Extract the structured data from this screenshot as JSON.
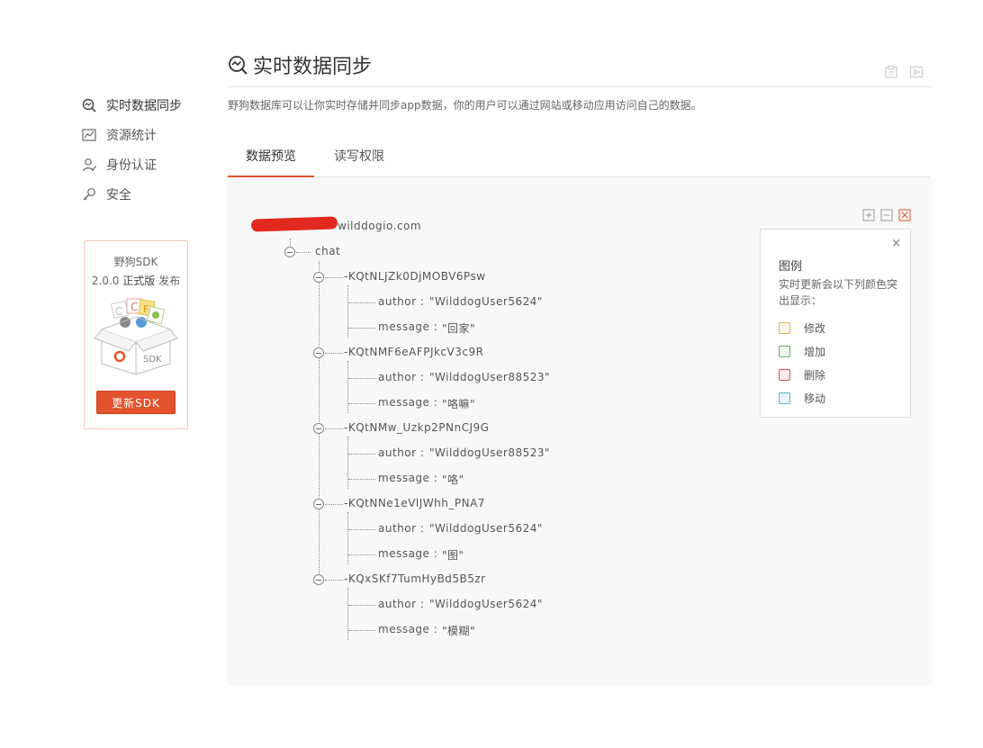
{
  "sidebar": {
    "items": [
      {
        "label": "实时数据同步",
        "icon": "realtime-sync-icon",
        "active": true
      },
      {
        "label": "资源统计",
        "icon": "chart-icon",
        "active": false
      },
      {
        "label": "身份认证",
        "icon": "user-auth-icon",
        "active": false
      },
      {
        "label": "安全",
        "icon": "key-icon",
        "active": false
      }
    ],
    "sdk": {
      "title": "野狗SDK",
      "version": "2.0.0",
      "edition": "正式版",
      "release": "发布",
      "box_label": "SDK",
      "button": "更新SDK"
    }
  },
  "header": {
    "title": "实时数据同步",
    "description": "野狗数据库可以让你实时存储并同步app数据，你的用户可以通过网站或移动应用访问自己的数据。"
  },
  "tabs": [
    {
      "label": "数据预览",
      "active": true
    },
    {
      "label": "读写权限",
      "active": false
    }
  ],
  "tree": {
    "root": "wilddogio.com",
    "chat": "chat",
    "nodes": [
      {
        "key": "-KQtNLJZk0DjMOBV6Psw",
        "author_key": "author :",
        "author": "\"WilddogUser5624\"",
        "message_key": "message :",
        "message": "\"回家\""
      },
      {
        "key": "-KQtNMF6eAFPJkcV3c9R",
        "author_key": "author :",
        "author": "\"WilddogUser88523\"",
        "message_key": "message :",
        "message": "\"咯嘛\""
      },
      {
        "key": "-KQtNMw_Uzkp2PNnCJ9G",
        "author_key": "author :",
        "author": "\"WilddogUser88523\"",
        "message_key": "message :",
        "message": "\"咯\""
      },
      {
        "key": "-KQtNNe1eVlJWhh_PNA7",
        "author_key": "author :",
        "author": "\"WilddogUser5624\"",
        "message_key": "message :",
        "message": "\"图\""
      },
      {
        "key": "-KQxSKf7TumHyBd5B5zr",
        "author_key": "author :",
        "author": "\"WilddogUser5624\"",
        "message_key": "message :",
        "message": "\"模糊\""
      }
    ]
  },
  "legend": {
    "title": "图例",
    "description": "实时更新会以下列颜色突出显示：",
    "close": "×",
    "items": [
      {
        "label": "修改",
        "color": "#f0a94a",
        "fill": "#fff8ec"
      },
      {
        "label": "增加",
        "color": "#5cb85c",
        "fill": "#eef8ee"
      },
      {
        "label": "删除",
        "color": "#d9534f",
        "fill": "#fcecec"
      },
      {
        "label": "移动",
        "color": "#5bafd6",
        "fill": "#eaf5fb"
      }
    ]
  },
  "colors": {
    "accent": "#e3522e"
  }
}
